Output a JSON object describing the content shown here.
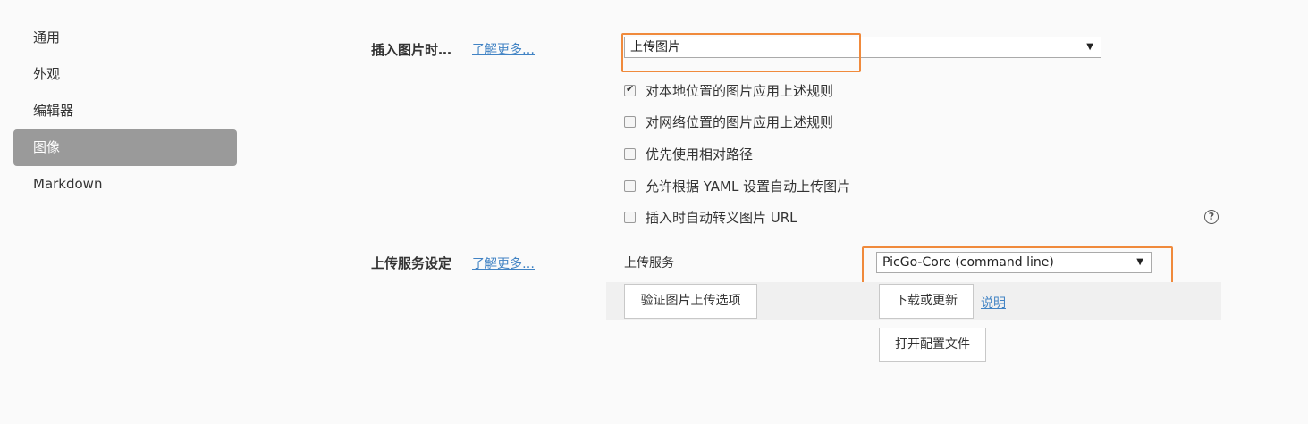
{
  "sidebar": {
    "items": [
      {
        "label": "通用"
      },
      {
        "label": "外观"
      },
      {
        "label": "编辑器"
      },
      {
        "label": "图像"
      },
      {
        "label": "Markdown"
      }
    ]
  },
  "insert_section": {
    "title": "插入图片时…",
    "learn_more": "了解更多…",
    "select_value": "上传图片",
    "options": [
      {
        "label": "对本地位置的图片应用上述规则",
        "checked": true
      },
      {
        "label": "对网络位置的图片应用上述规则",
        "checked": false
      },
      {
        "label": "优先使用相对路径",
        "checked": false
      },
      {
        "label": "允许根据 YAML 设置自动上传图片",
        "checked": false
      },
      {
        "label": "插入时自动转义图片 URL",
        "checked": false
      }
    ],
    "help_glyph": "?"
  },
  "upload_section": {
    "title": "上传服务设定",
    "learn_more": "了解更多…",
    "service_label": "上传服务",
    "service_value": "PicGo-Core (command line)",
    "verify_button": "验证图片上传选项",
    "download_button": "下载或更新",
    "explain_link": "说明",
    "open_config_button": "打开配置文件"
  },
  "colors": {
    "highlight": "#f08a3c",
    "active_nav": "#9a9a9a",
    "link": "#4183c4"
  }
}
